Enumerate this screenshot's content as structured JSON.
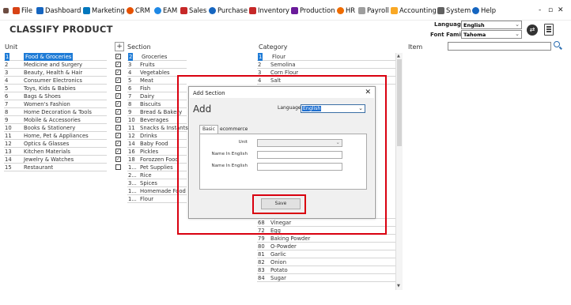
{
  "menu": {
    "items": [
      {
        "label": "File",
        "icon": "file-icon",
        "color": "#d84315"
      },
      {
        "label": "Dashboard",
        "icon": "dashboard-icon",
        "color": "#1565c0"
      },
      {
        "label": "Marketing",
        "icon": "marketing-icon",
        "color": "#0277bd"
      },
      {
        "label": "CRM",
        "icon": "crm-icon",
        "color": "#e65100"
      },
      {
        "label": "EAM",
        "icon": "eam-icon",
        "color": "#1e88e5"
      },
      {
        "label": "Sales",
        "icon": "sales-icon",
        "color": "#c62828"
      },
      {
        "label": "Purchase",
        "icon": "purchase-icon",
        "color": "#1565c0"
      },
      {
        "label": "Inventory",
        "icon": "inventory-icon",
        "color": "#c62828"
      },
      {
        "label": "Production",
        "icon": "production-icon",
        "color": "#6a1b9a"
      },
      {
        "label": "HR",
        "icon": "hr-icon",
        "color": "#ef6c00"
      },
      {
        "label": "Payroll",
        "icon": "payroll-icon",
        "color": "#757575"
      },
      {
        "label": "Accounting",
        "icon": "accounting-icon",
        "color": "#f9a825"
      },
      {
        "label": "System",
        "icon": "system-icon",
        "color": "#616161"
      },
      {
        "label": "Help",
        "icon": "help-icon",
        "color": "#1565c0"
      }
    ],
    "window_controls": {
      "minimize": "-",
      "restore": "▫",
      "close": "✕"
    }
  },
  "page": {
    "title": "CLASSIFY PRODUCT",
    "language_label": "Language",
    "language_value": "English",
    "font_family_label": "Font Family",
    "font_family_value": "Tahoma"
  },
  "headers": {
    "unit": "Unit",
    "section": "Section",
    "category": "Category",
    "item": "Item",
    "add": "+"
  },
  "units": [
    {
      "num": "1",
      "name": "Food & Groceries",
      "checked": true,
      "selected": true
    },
    {
      "num": "2",
      "name": "Medicine and Surgery",
      "checked": true
    },
    {
      "num": "3",
      "name": "Beauty, Health & Hair",
      "checked": true
    },
    {
      "num": "4",
      "name": "Consumer Electronics",
      "checked": true
    },
    {
      "num": "5",
      "name": "Toys, Kids & Babies",
      "checked": true
    },
    {
      "num": "6",
      "name": "Bags & Shoes",
      "checked": true
    },
    {
      "num": "7",
      "name": "Women's Fashion",
      "checked": true
    },
    {
      "num": "8",
      "name": "Home Decoration & Tools",
      "checked": true
    },
    {
      "num": "9",
      "name": "Mobile & Accessories",
      "checked": true
    },
    {
      "num": "10",
      "name": "Books & Stationery",
      "checked": true
    },
    {
      "num": "11",
      "name": "Home, Pet & Appliances",
      "checked": true
    },
    {
      "num": "12",
      "name": "Optics & Glasses",
      "checked": true
    },
    {
      "num": "13",
      "name": "Kitchen Materials",
      "checked": true
    },
    {
      "num": "14",
      "name": "Jewelry & Watches",
      "checked": true
    },
    {
      "num": "15",
      "name": "Restaurant",
      "checked": false
    }
  ],
  "sections": [
    {
      "num": "2",
      "name": "Groceries",
      "selected": true
    },
    {
      "num": "3",
      "name": "Fruits"
    },
    {
      "num": "4",
      "name": "Vegetables"
    },
    {
      "num": "5",
      "name": "Meat"
    },
    {
      "num": "6",
      "name": "Fish"
    },
    {
      "num": "7",
      "name": "Dairy"
    },
    {
      "num": "8",
      "name": "Biscuits"
    },
    {
      "num": "9",
      "name": "Bread & Bakery"
    },
    {
      "num": "10",
      "name": "Beverages"
    },
    {
      "num": "11",
      "name": "Snacks & Instants"
    },
    {
      "num": "12",
      "name": "Drinks"
    },
    {
      "num": "14",
      "name": "Baby Food"
    },
    {
      "num": "16",
      "name": "Pickles"
    },
    {
      "num": "18",
      "name": "Forozzen Food"
    },
    {
      "num": "1...",
      "name": "Pet Supplies"
    },
    {
      "num": "2...",
      "name": "Rice"
    },
    {
      "num": "3...",
      "name": "Spices"
    },
    {
      "num": "1...",
      "name": "Homemade Food"
    },
    {
      "num": "1...",
      "name": "Flour"
    }
  ],
  "categories_top": [
    {
      "num": "1",
      "name": "Flour",
      "selected": true
    },
    {
      "num": "2",
      "name": "Semolina"
    },
    {
      "num": "3",
      "name": "Corn Flour"
    },
    {
      "num": "4",
      "name": "Salt"
    }
  ],
  "categories_bottom": [
    {
      "num": "68",
      "name": "Vinegar"
    },
    {
      "num": "72",
      "name": "Egg"
    },
    {
      "num": "79",
      "name": "Baking Powder"
    },
    {
      "num": "80",
      "name": "O-Powder"
    },
    {
      "num": "81",
      "name": "Garlic"
    },
    {
      "num": "82",
      "name": "Onion"
    },
    {
      "num": "83",
      "name": "Potato"
    },
    {
      "num": "84",
      "name": "Sugar"
    }
  ],
  "dialog": {
    "title": "Add Section",
    "heading": "Add",
    "close": "✕",
    "language_label": "Language",
    "language_value": "English",
    "tabs": [
      "Basic",
      "ecommerce"
    ],
    "fields": {
      "unit": "Unit",
      "name_in_english_1": "Name In English",
      "name_in_english_2": "Name In English"
    },
    "save": "Save"
  },
  "colors": {
    "highlight": "#d9000f",
    "selection": "#1e7bd6"
  }
}
